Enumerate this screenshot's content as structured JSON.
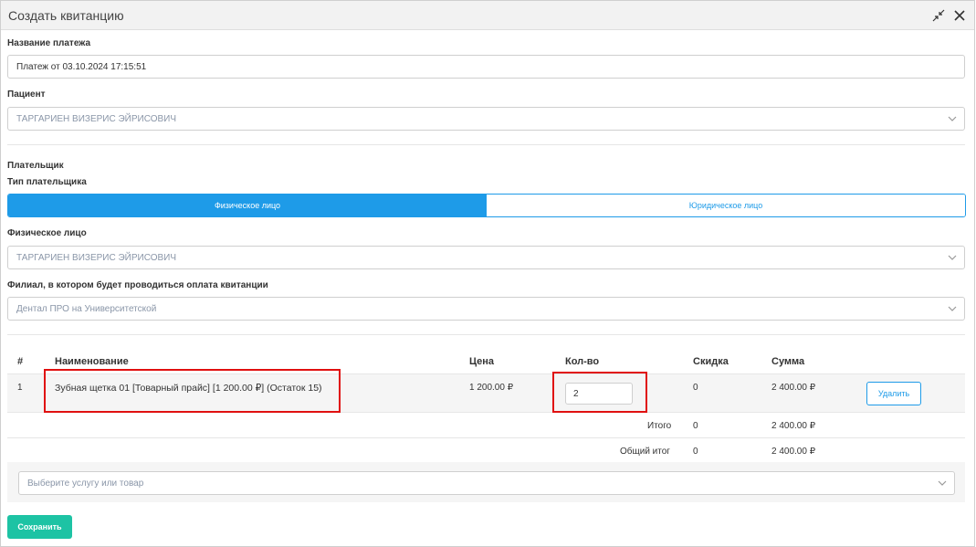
{
  "dialog": {
    "title": "Создать квитанцию"
  },
  "payment_name": {
    "label": "Название платежа",
    "value": "Платеж от 03.10.2024 17:15:51"
  },
  "patient": {
    "label": "Пациент",
    "value": "ТАРГАРИЕН ВИЗЕРИС ЭЙРИСОВИЧ"
  },
  "payer": {
    "section_label": "Плательщик",
    "type_label": "Тип плательщика",
    "types": [
      {
        "label": "Физическое лицо",
        "active": true
      },
      {
        "label": "Юридическое лицо",
        "active": false
      }
    ],
    "person_label": "Физическое лицо",
    "person_value": "ТАРГАРИЕН ВИЗЕРИС ЭЙРИСОВИЧ"
  },
  "branch": {
    "label": "Филиал, в котором будет проводиться оплата квитанции",
    "value": "Дентал ПРО на Университетской"
  },
  "table": {
    "headers": {
      "num": "#",
      "name": "Наименование",
      "price": "Цена",
      "qty": "Кол-во",
      "discount": "Скидка",
      "sum": "Сумма"
    },
    "rows": [
      {
        "num": "1",
        "name": "Зубная щетка 01 [Товарный прайс] [1 200.00 ₽] (Остаток 15)",
        "price": "1 200.00 ₽",
        "qty": "2",
        "discount": "0",
        "sum": "2 400.00 ₽",
        "delete_label": "Удалить"
      }
    ],
    "subtotal": {
      "label": "Итого",
      "discount": "0",
      "sum": "2 400.00 ₽"
    },
    "total": {
      "label": "Общий итог",
      "discount": "0",
      "sum": "2 400.00 ₽"
    }
  },
  "add_item": {
    "placeholder": "Выберите услугу или товар"
  },
  "save_label": "Сохранить",
  "colors": {
    "accent": "#1e9be8",
    "save": "#1dc3a4",
    "highlight": "#e01010"
  },
  "icons": {
    "collapse": "collapse-icon",
    "close": "close-icon",
    "dropdown": "chevron-down-icon"
  }
}
